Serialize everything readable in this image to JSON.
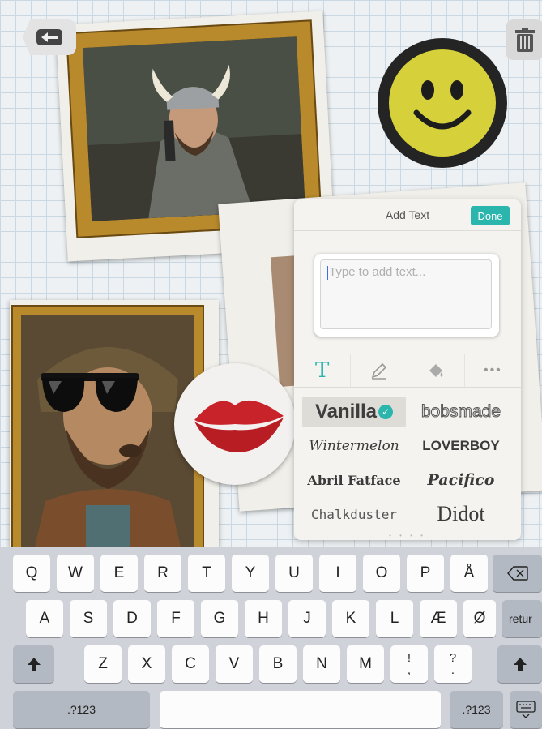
{
  "toolbar": {
    "back_icon": "arrow-left-icon",
    "trash_icon": "trash-icon"
  },
  "stickers": {
    "smiley": "smiley-sticker",
    "lips": "lips-sticker",
    "sunglasses": "sunglasses-sticker"
  },
  "add_text_panel": {
    "title": "Add Text",
    "done_label": "Done",
    "text_input": {
      "value": "",
      "placeholder": "Type to add text..."
    },
    "tabs": [
      {
        "label": "T",
        "icon": "text-font-icon"
      },
      {
        "label": "",
        "icon": "pen-color-icon"
      },
      {
        "label": "",
        "icon": "fill-bucket-icon"
      },
      {
        "label": "•••",
        "icon": "more-icon"
      }
    ],
    "fonts": [
      {
        "label": "Vanilla",
        "selected": true
      },
      {
        "label": "bobsmade",
        "selected": false
      },
      {
        "label": "Wintermelon",
        "selected": false
      },
      {
        "label": "LOVERBOY",
        "selected": false
      },
      {
        "label": "Abril Fatface",
        "selected": false
      },
      {
        "label": "Pacifico",
        "selected": false
      },
      {
        "label": "Chalkduster",
        "selected": false
      },
      {
        "label": "Didot",
        "selected": false
      }
    ],
    "page_dots": "• • • •"
  },
  "keyboard": {
    "row1": [
      "Q",
      "W",
      "E",
      "R",
      "T",
      "Y",
      "U",
      "I",
      "O",
      "P",
      "Å"
    ],
    "row2": [
      "A",
      "S",
      "D",
      "F",
      "G",
      "H",
      "J",
      "K",
      "L",
      "Æ",
      "Ø"
    ],
    "row3": [
      "Z",
      "X",
      "C",
      "V",
      "B",
      "N",
      "M",
      "!\n,",
      "?\n."
    ],
    "return_label": "retur",
    "numbers_label": ".?123",
    "numbers_label_right": ".?123"
  },
  "colors": {
    "accent": "#2ab5ad",
    "gold_frame": "#b88a2c",
    "smiley_yellow": "#d6d13a",
    "lips_red": "#c8232a"
  }
}
